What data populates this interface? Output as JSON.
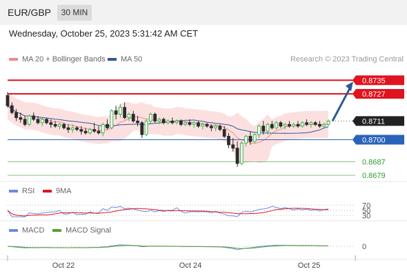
{
  "header": {
    "symbol": "EUR/GBP",
    "timeframe": "30 MIN"
  },
  "datetime": "Wednesday, October 25, 2023 5:31:42 AM CET",
  "legend": {
    "ma20": "MA 20 + Bollinger Bands",
    "ma50": "MA 50",
    "credit": "Research © 2023 Trading Central"
  },
  "rsi_legend": {
    "rsi": "RSI",
    "ma9": "9MA"
  },
  "macd_legend": {
    "macd": "MACD",
    "signal": "MACD Signal"
  },
  "colors": {
    "resistance": "#e0141e",
    "support": "#2a64b8",
    "target": "#2e9a2e",
    "up": "#3cb44b",
    "down": "#2b2b2b",
    "band": "#fbd5d5",
    "ma20": "#f08a8a",
    "ma50": "#2d5a96",
    "current": "#222222"
  },
  "chart_data": [
    {
      "type": "candlestick",
      "x_ticks": [
        "Oct 22",
        "Oct 24",
        "Oct 25"
      ],
      "series": [
        {
          "name": "MA 20 + Bollinger Bands"
        },
        {
          "name": "MA 50"
        }
      ],
      "price_range": [
        0.8675,
        0.874
      ],
      "candles": [
        {
          "o": 0.8726,
          "h": 0.8728,
          "l": 0.8719,
          "c": 0.872
        },
        {
          "o": 0.872,
          "h": 0.8722,
          "l": 0.8715,
          "c": 0.8716
        },
        {
          "o": 0.8716,
          "h": 0.8718,
          "l": 0.8711,
          "c": 0.8713
        },
        {
          "o": 0.8713,
          "h": 0.8716,
          "l": 0.871,
          "c": 0.8712
        },
        {
          "o": 0.8712,
          "h": 0.8714,
          "l": 0.8708,
          "c": 0.8709
        },
        {
          "o": 0.8709,
          "h": 0.8715,
          "l": 0.8708,
          "c": 0.8714
        },
        {
          "o": 0.8714,
          "h": 0.8716,
          "l": 0.8711,
          "c": 0.8712
        },
        {
          "o": 0.8712,
          "h": 0.8714,
          "l": 0.8709,
          "c": 0.871
        },
        {
          "o": 0.871,
          "h": 0.8713,
          "l": 0.8708,
          "c": 0.8712
        },
        {
          "o": 0.8712,
          "h": 0.8713,
          "l": 0.8709,
          "c": 0.871
        },
        {
          "o": 0.871,
          "h": 0.8712,
          "l": 0.8707,
          "c": 0.8709
        },
        {
          "o": 0.8709,
          "h": 0.8711,
          "l": 0.8707,
          "c": 0.8708
        },
        {
          "o": 0.8708,
          "h": 0.871,
          "l": 0.8706,
          "c": 0.8709
        },
        {
          "o": 0.8709,
          "h": 0.871,
          "l": 0.8706,
          "c": 0.8707
        },
        {
          "o": 0.8707,
          "h": 0.8709,
          "l": 0.8704,
          "c": 0.8706
        },
        {
          "o": 0.8706,
          "h": 0.8709,
          "l": 0.8704,
          "c": 0.8707
        },
        {
          "o": 0.8707,
          "h": 0.8708,
          "l": 0.8705,
          "c": 0.8706
        },
        {
          "o": 0.8706,
          "h": 0.8708,
          "l": 0.8703,
          "c": 0.8705
        },
        {
          "o": 0.8705,
          "h": 0.8707,
          "l": 0.8703,
          "c": 0.8704
        },
        {
          "o": 0.8704,
          "h": 0.8707,
          "l": 0.8703,
          "c": 0.8706
        },
        {
          "o": 0.8706,
          "h": 0.871,
          "l": 0.8704,
          "c": 0.8705
        },
        {
          "o": 0.8705,
          "h": 0.8708,
          "l": 0.8703,
          "c": 0.8704
        },
        {
          "o": 0.8704,
          "h": 0.871,
          "l": 0.8702,
          "c": 0.8709
        },
        {
          "o": 0.8709,
          "h": 0.8712,
          "l": 0.8706,
          "c": 0.8707
        },
        {
          "o": 0.8707,
          "h": 0.8718,
          "l": 0.8706,
          "c": 0.8717
        },
        {
          "o": 0.8717,
          "h": 0.872,
          "l": 0.8712,
          "c": 0.8715
        },
        {
          "o": 0.8715,
          "h": 0.8721,
          "l": 0.8713,
          "c": 0.8719
        },
        {
          "o": 0.8719,
          "h": 0.8722,
          "l": 0.8712,
          "c": 0.8713
        },
        {
          "o": 0.8713,
          "h": 0.8716,
          "l": 0.8711,
          "c": 0.8715
        },
        {
          "o": 0.8715,
          "h": 0.8717,
          "l": 0.871,
          "c": 0.8711
        },
        {
          "o": 0.8711,
          "h": 0.8714,
          "l": 0.8708,
          "c": 0.871
        },
        {
          "o": 0.871,
          "h": 0.8711,
          "l": 0.8701,
          "c": 0.8703
        },
        {
          "o": 0.8703,
          "h": 0.8712,
          "l": 0.8702,
          "c": 0.8711
        },
        {
          "o": 0.8711,
          "h": 0.8716,
          "l": 0.8709,
          "c": 0.8715
        },
        {
          "o": 0.8715,
          "h": 0.8716,
          "l": 0.871,
          "c": 0.8711
        },
        {
          "o": 0.8711,
          "h": 0.8713,
          "l": 0.8709,
          "c": 0.8712
        },
        {
          "o": 0.8712,
          "h": 0.8713,
          "l": 0.8709,
          "c": 0.871
        },
        {
          "o": 0.871,
          "h": 0.8712,
          "l": 0.8709,
          "c": 0.8711
        },
        {
          "o": 0.8711,
          "h": 0.8713,
          "l": 0.8709,
          "c": 0.871
        },
        {
          "o": 0.871,
          "h": 0.8712,
          "l": 0.8709,
          "c": 0.8711
        },
        {
          "o": 0.8711,
          "h": 0.8712,
          "l": 0.8708,
          "c": 0.8709
        },
        {
          "o": 0.8709,
          "h": 0.8711,
          "l": 0.8708,
          "c": 0.871
        },
        {
          "o": 0.871,
          "h": 0.8712,
          "l": 0.8708,
          "c": 0.8709
        },
        {
          "o": 0.8709,
          "h": 0.8711,
          "l": 0.8707,
          "c": 0.871
        },
        {
          "o": 0.871,
          "h": 0.8711,
          "l": 0.8707,
          "c": 0.8708
        },
        {
          "o": 0.8708,
          "h": 0.871,
          "l": 0.8706,
          "c": 0.8709
        },
        {
          "o": 0.8709,
          "h": 0.871,
          "l": 0.8707,
          "c": 0.8708
        },
        {
          "o": 0.8708,
          "h": 0.8709,
          "l": 0.8705,
          "c": 0.8707
        },
        {
          "o": 0.8707,
          "h": 0.8709,
          "l": 0.8705,
          "c": 0.8708
        },
        {
          "o": 0.8708,
          "h": 0.8709,
          "l": 0.8705,
          "c": 0.8706
        },
        {
          "o": 0.8706,
          "h": 0.8708,
          "l": 0.8701,
          "c": 0.8702
        },
        {
          "o": 0.8702,
          "h": 0.8704,
          "l": 0.8695,
          "c": 0.8697
        },
        {
          "o": 0.8697,
          "h": 0.8701,
          "l": 0.8693,
          "c": 0.8695
        },
        {
          "o": 0.8695,
          "h": 0.8699,
          "l": 0.8684,
          "c": 0.8686
        },
        {
          "o": 0.8686,
          "h": 0.8699,
          "l": 0.8685,
          "c": 0.8698
        },
        {
          "o": 0.8698,
          "h": 0.8703,
          "l": 0.8696,
          "c": 0.8702
        },
        {
          "o": 0.8702,
          "h": 0.8705,
          "l": 0.8697,
          "c": 0.8699
        },
        {
          "o": 0.8699,
          "h": 0.8704,
          "l": 0.8698,
          "c": 0.8703
        },
        {
          "o": 0.8703,
          "h": 0.8709,
          "l": 0.8701,
          "c": 0.8708
        },
        {
          "o": 0.8708,
          "h": 0.8711,
          "l": 0.8703,
          "c": 0.8705
        },
        {
          "o": 0.8705,
          "h": 0.871,
          "l": 0.8703,
          "c": 0.8709
        },
        {
          "o": 0.8709,
          "h": 0.8711,
          "l": 0.8706,
          "c": 0.8707
        },
        {
          "o": 0.8707,
          "h": 0.8711,
          "l": 0.8706,
          "c": 0.871
        },
        {
          "o": 0.871,
          "h": 0.8711,
          "l": 0.8707,
          "c": 0.8708
        },
        {
          "o": 0.8708,
          "h": 0.871,
          "l": 0.8706,
          "c": 0.8709
        },
        {
          "o": 0.8709,
          "h": 0.8711,
          "l": 0.8707,
          "c": 0.8708
        },
        {
          "o": 0.8708,
          "h": 0.871,
          "l": 0.8707,
          "c": 0.8709
        },
        {
          "o": 0.8709,
          "h": 0.8711,
          "l": 0.8707,
          "c": 0.8708
        },
        {
          "o": 0.8708,
          "h": 0.8711,
          "l": 0.8707,
          "c": 0.871
        },
        {
          "o": 0.871,
          "h": 0.8712,
          "l": 0.8708,
          "c": 0.8709
        },
        {
          "o": 0.8709,
          "h": 0.8711,
          "l": 0.8707,
          "c": 0.871
        },
        {
          "o": 0.871,
          "h": 0.8711,
          "l": 0.8708,
          "c": 0.8709
        },
        {
          "o": 0.8709,
          "h": 0.8711,
          "l": 0.8707,
          "c": 0.8708
        },
        {
          "o": 0.8708,
          "h": 0.871,
          "l": 0.8707,
          "c": 0.8709
        },
        {
          "o": 0.8709,
          "h": 0.8712,
          "l": 0.8708,
          "c": 0.8711
        }
      ],
      "levels": [
        {
          "value": 0.8735,
          "label": "0.8735",
          "kind": "resistance"
        },
        {
          "value": 0.8727,
          "label": "0.8727",
          "kind": "resistance"
        },
        {
          "value": 0.8711,
          "label": "0.8711",
          "kind": "current"
        },
        {
          "value": 0.87,
          "label": "0.8700",
          "kind": "support"
        },
        {
          "value": 0.8687,
          "label": "0.8687",
          "kind": "target"
        },
        {
          "value": 0.8679,
          "label": "0.8679",
          "kind": "target"
        }
      ],
      "arrow": {
        "from_value": 0.8711,
        "to_value": 0.8735
      }
    },
    {
      "type": "line",
      "series": [
        {
          "name": "RSI"
        },
        {
          "name": "9MA"
        }
      ],
      "y_ticks": [
        70,
        50,
        30
      ]
    },
    {
      "type": "line",
      "series": [
        {
          "name": "MACD"
        },
        {
          "name": "MACD Signal"
        }
      ],
      "y_ticks": [
        0
      ]
    }
  ]
}
